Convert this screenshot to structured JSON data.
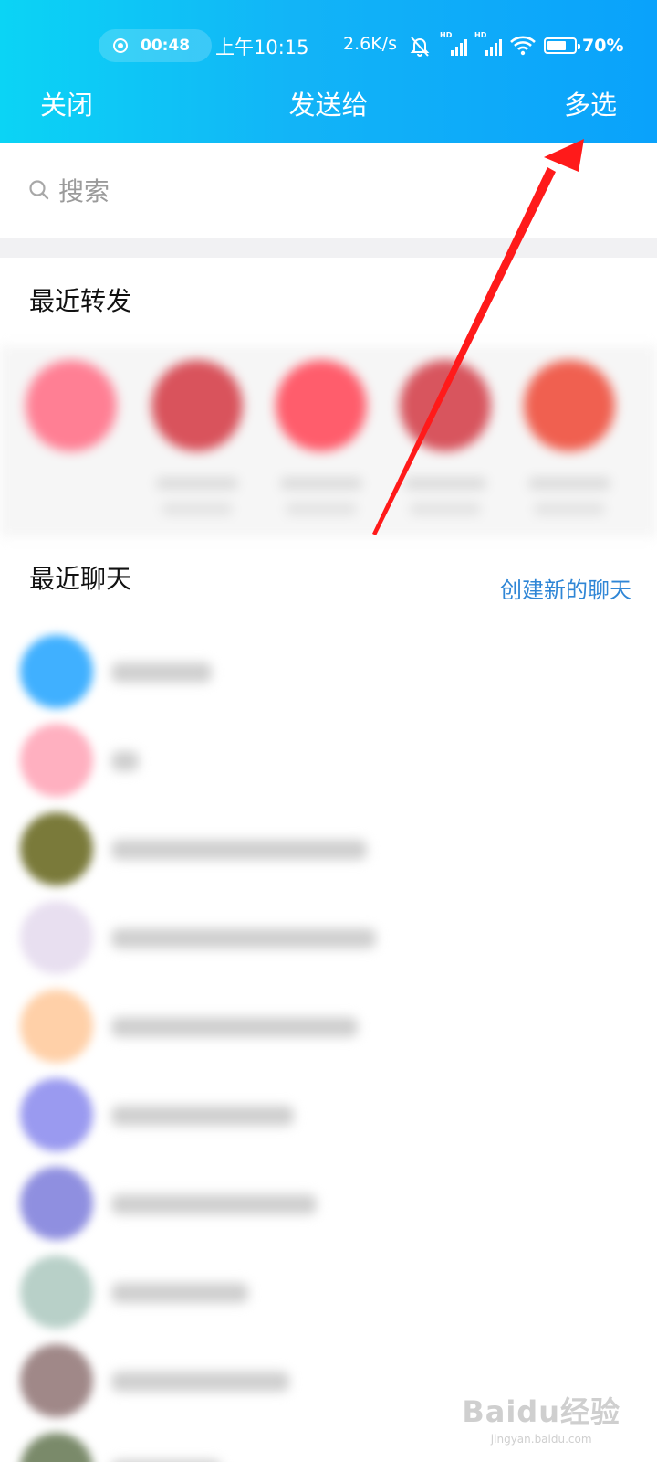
{
  "status_bar": {
    "recording_time": "00:48",
    "clock": "上午10:15",
    "net_speed": "2.6K/s",
    "signal1_label": "HD",
    "signal2_label": "HD",
    "battery_text": "70%",
    "battery_level": 0.7,
    "icons": [
      "record-icon",
      "mute-bell-icon",
      "signal-icon",
      "signal-icon",
      "wifi-icon",
      "battery-icon"
    ]
  },
  "nav": {
    "close_label": "关闭",
    "title": "发送给",
    "multi_select_label": "多选"
  },
  "search": {
    "placeholder": "搜索",
    "icon": "search-icon"
  },
  "recent_forward": {
    "title": "最近转发",
    "avatar_colors": [
      "#ff7f94",
      "#d9535c",
      "#ff5d6c",
      "#d8555e",
      "#f06050"
    ]
  },
  "recent_chats": {
    "title": "最近聊天",
    "create_label": "创建新的聊天",
    "avatar_colors": [
      "#40b0ff",
      "#ffb0c0",
      "#7a7a3a",
      "#e8dff0",
      "#ffd0a8",
      "#9a9af0",
      "#8f8fe0",
      "#b8d0c8",
      "#a08888",
      "#7a8a6a"
    ]
  },
  "watermark": {
    "main": "Baidu经验",
    "sub": "jingyan.baidu.com"
  },
  "colors": {
    "header_start": "#0bd4f5",
    "header_end": "#0aa2fb",
    "link": "#2f86d6",
    "annotation_arrow": "#ff1a1a"
  }
}
